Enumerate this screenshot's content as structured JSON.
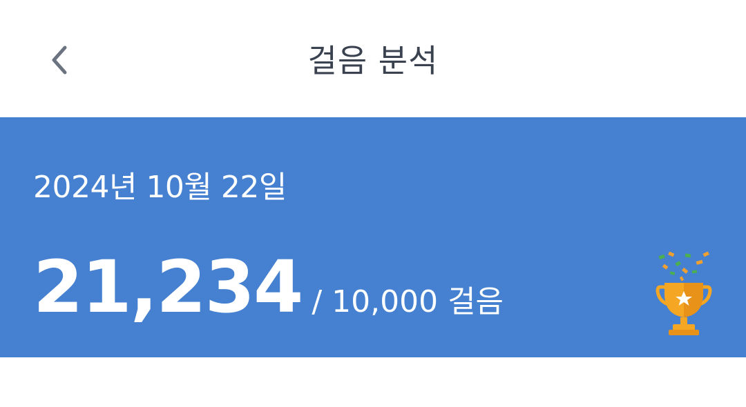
{
  "header": {
    "title": "걸음 분석",
    "back_icon": "chevron-left-icon"
  },
  "summary": {
    "date": "2024년 10월 22일",
    "steps": "21,234",
    "goal_text": "/ 10,000 걸음",
    "badge_icon": "trophy-icon",
    "background_color": "#4581d0"
  }
}
